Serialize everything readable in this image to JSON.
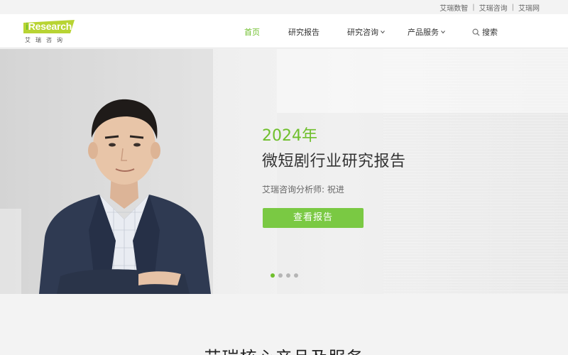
{
  "topbar": {
    "links": [
      "艾瑞数智",
      "艾瑞咨询",
      "艾瑞网"
    ],
    "separator": "|"
  },
  "logo": {
    "wordmark_i": "i",
    "wordmark_rest": "Research",
    "subtitle": "艾瑞咨询",
    "brand_color": "#6fbf2c"
  },
  "nav": {
    "home": "首页",
    "reports": "研究报告",
    "consulting": "研究咨询",
    "products": "产品服务",
    "search": "搜索"
  },
  "hero": {
    "year": "2024年",
    "title": "微短剧行业研究报告",
    "analyst": "艾瑞咨询分析师:  祝进",
    "button": "查看报告",
    "accent": "#7ac943",
    "carousel_total": 4,
    "carousel_active": 1
  },
  "section": {
    "title": "艾瑞核心产品及服务"
  }
}
